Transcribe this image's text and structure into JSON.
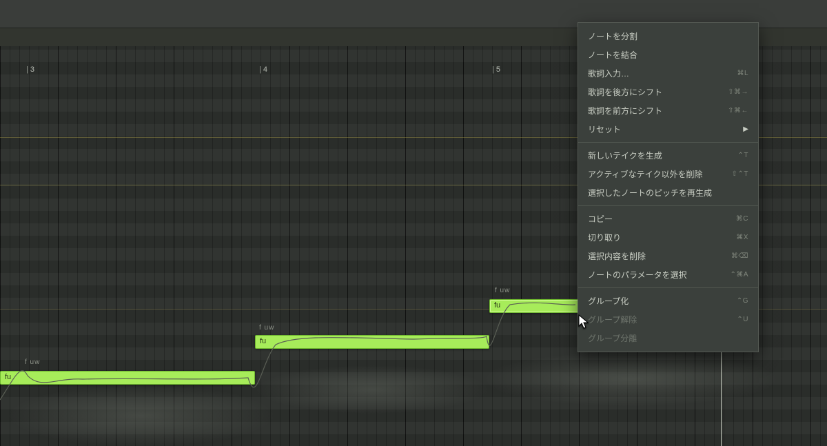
{
  "ruler": {
    "3": "3",
    "4": "4",
    "5": "5"
  },
  "notes": [
    {
      "phoneme": "f uw",
      "lyric": "fu"
    },
    {
      "phoneme": "f uw",
      "lyric": "fu"
    },
    {
      "phoneme": "f uw",
      "lyric": "fu"
    }
  ],
  "menu": {
    "split": {
      "label": "ノートを分割",
      "shortcut": ""
    },
    "merge": {
      "label": "ノートを結合",
      "shortcut": ""
    },
    "lyrics": {
      "label": "歌詞入力…",
      "shortcut": "⌘L"
    },
    "shiftBack": {
      "label": "歌詞を後方にシフト",
      "shortcut": "⇧⌘→"
    },
    "shiftFwd": {
      "label": "歌詞を前方にシフト",
      "shortcut": "⇧⌘←"
    },
    "reset": {
      "label": "リセット",
      "shortcut": ""
    },
    "newTake": {
      "label": "新しいテイクを生成",
      "shortcut": "⌃T"
    },
    "delTakes": {
      "label": "アクティブなテイク以外を削除",
      "shortcut": "⇧⌃T"
    },
    "regenPitch": {
      "label": "選択したノートのピッチを再生成",
      "shortcut": ""
    },
    "copy": {
      "label": "コピー",
      "shortcut": "⌘C"
    },
    "cut": {
      "label": "切り取り",
      "shortcut": "⌘X"
    },
    "delete": {
      "label": "選択内容を削除",
      "shortcut": "⌘⌫"
    },
    "selParams": {
      "label": "ノートのパラメータを選択",
      "shortcut": "⌃⌘A"
    },
    "group": {
      "label": "グループ化",
      "shortcut": "⌃G"
    },
    "ungroup": {
      "label": "グループ解除",
      "shortcut": "⌃U"
    },
    "groupSep": {
      "label": "グループ分離",
      "shortcut": ""
    }
  }
}
